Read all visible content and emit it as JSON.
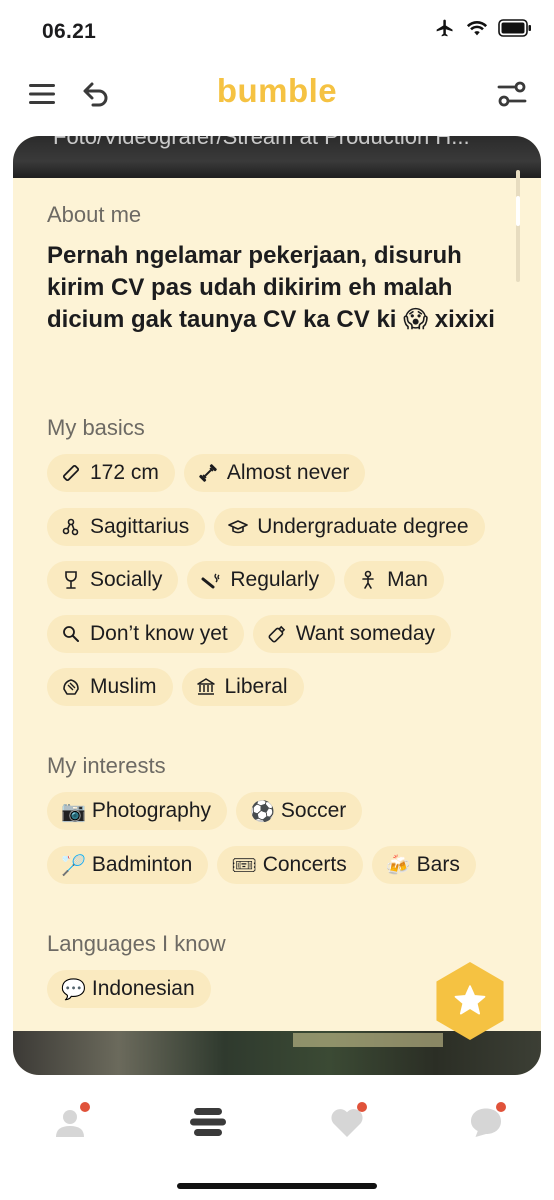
{
  "status_bar": {
    "time": "06.21"
  },
  "header": {
    "brand": "bumble"
  },
  "card": {
    "photo_caption": "Foto/Videografer/Stream at Production H..."
  },
  "about": {
    "label": "About me",
    "text": "Pernah ngelamar pekerjaan, disuruh kirim CV pas udah dikirim eh malah dicium gak taunya CV ka CV ki 😱 xixixi"
  },
  "basics": {
    "label": "My basics",
    "chips": [
      {
        "icon": "ruler-icon",
        "label": "172 cm"
      },
      {
        "icon": "dumbbell-icon",
        "label": "Almost never"
      },
      {
        "icon": "zodiac-icon",
        "label": "Sagittarius"
      },
      {
        "icon": "graduation-cap-icon",
        "label": "Undergraduate degree"
      },
      {
        "icon": "wine-glass-icon",
        "label": "Socially"
      },
      {
        "icon": "smoking-icon",
        "label": "Regularly"
      },
      {
        "icon": "person-icon",
        "label": "Man"
      },
      {
        "icon": "search-icon",
        "label": "Don’t know yet"
      },
      {
        "icon": "bottle-icon",
        "label": "Want someday"
      },
      {
        "icon": "praying-hands-icon",
        "label": "Muslim"
      },
      {
        "icon": "government-building-icon",
        "label": "Liberal"
      }
    ]
  },
  "interests": {
    "label": "My interests",
    "chips": [
      {
        "emoji": "📷",
        "label": "Photography"
      },
      {
        "emoji": "⚽",
        "label": "Soccer"
      },
      {
        "emoji": "🏸",
        "label": "Badminton"
      },
      {
        "emoji": "🎟",
        "label": "Concerts"
      },
      {
        "emoji": "🍻",
        "label": "Bars"
      }
    ]
  },
  "languages": {
    "label": "Languages I know",
    "chips": [
      {
        "emoji": "💬",
        "label": "Indonesian"
      }
    ]
  },
  "colors": {
    "brand": "#f5c242",
    "chip": "#faeac0",
    "card": "#fdf3d6",
    "badge": "#e0523a"
  }
}
